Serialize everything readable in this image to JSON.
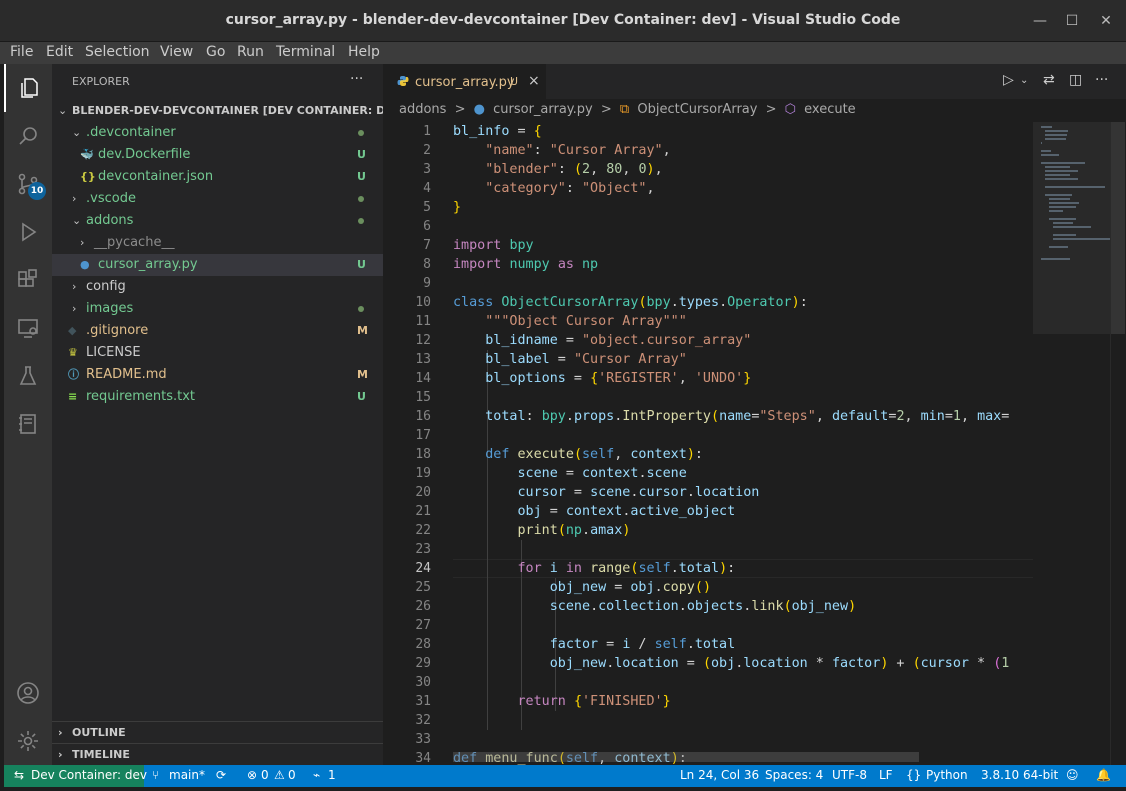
{
  "window": {
    "title": "cursor_array.py - blender-dev-devcontainer [Dev Container: dev] - Visual Studio Code"
  },
  "menu": [
    "File",
    "Edit",
    "Selection",
    "View",
    "Go",
    "Run",
    "Terminal",
    "Help"
  ],
  "activity": {
    "scm_badge": "10"
  },
  "explorer": {
    "header": "EXPLORER",
    "more": "···",
    "root": "BLENDER-DEV-DEVCONTAINER [DEV CONTAINER: DEV]",
    "items": [
      {
        "label": ".devcontainer",
        "kind": "folder-open",
        "status": "dot",
        "color": "#73c991"
      },
      {
        "label": "dev.Dockerfile",
        "kind": "docker",
        "status": "U",
        "color": "#73c991"
      },
      {
        "label": "devcontainer.json",
        "kind": "json",
        "status": "U",
        "color": "#73c991"
      },
      {
        "label": ".vscode",
        "kind": "folder",
        "status": "dot",
        "color": "#73c991"
      },
      {
        "label": "addons",
        "kind": "folder-open",
        "status": "dot",
        "color": "#73c991"
      },
      {
        "label": "__pycache__",
        "kind": "folder",
        "status": "",
        "color": "#8c8c8c"
      },
      {
        "label": "cursor_array.py",
        "kind": "python",
        "status": "U",
        "color": "#73c991"
      },
      {
        "label": "config",
        "kind": "folder",
        "status": "",
        "color": "#cccccc"
      },
      {
        "label": "images",
        "kind": "folder",
        "status": "dot",
        "color": "#73c991"
      },
      {
        "label": ".gitignore",
        "kind": "gitignore",
        "status": "M",
        "color": "#e2c08d"
      },
      {
        "label": "LICENSE",
        "kind": "license",
        "status": "",
        "color": "#cccccc"
      },
      {
        "label": "README.md",
        "kind": "info",
        "status": "M",
        "color": "#e2c08d"
      },
      {
        "label": "requirements.txt",
        "kind": "text",
        "status": "U",
        "color": "#73c991"
      }
    ],
    "outline": "OUTLINE",
    "timeline": "TIMELINE"
  },
  "editor": {
    "tab": {
      "name": "cursor_array.py",
      "status": "U",
      "close": "×"
    },
    "breadcrumb": [
      "addons",
      ">",
      "cursor_array.py",
      ">",
      "ObjectCursorArray",
      ">",
      "execute"
    ],
    "current_line": 24,
    "line_numbers": [
      "1",
      "2",
      "3",
      "4",
      "5",
      "6",
      "7",
      "8",
      "9",
      "10",
      "11",
      "12",
      "13",
      "14",
      "15",
      "16",
      "17",
      "18",
      "19",
      "20",
      "21",
      "22",
      "23",
      "24",
      "25",
      "26",
      "27",
      "28",
      "29",
      "30",
      "31",
      "32",
      "33",
      "34"
    ],
    "code": [
      "bl_info = {",
      "    \"name\": \"Cursor Array\",",
      "    \"blender\": (2, 80, 0),",
      "    \"category\": \"Object\",",
      "}",
      "",
      "import bpy",
      "import numpy as np",
      "",
      "class ObjectCursorArray(bpy.types.Operator):",
      "    \"\"\"Object Cursor Array\"\"\"",
      "    bl_idname = \"object.cursor_array\"",
      "    bl_label = \"Cursor Array\"",
      "    bl_options = {'REGISTER', 'UNDO'}",
      "",
      "    total: bpy.props.IntProperty(name=\"Steps\", default=2, min=1, max=",
      "",
      "    def execute(self, context):",
      "        scene = context.scene",
      "        cursor = scene.cursor.location",
      "        obj = context.active_object",
      "        print(np.amax)",
      "",
      "        for i in range(self.total):",
      "            obj_new = obj.copy()",
      "            scene.collection.objects.link(obj_new)",
      "",
      "            factor = i / self.total",
      "            obj_new.location = (obj.location * factor) + (cursor * (1",
      "",
      "        return {'FINISHED'}",
      "",
      "",
      "def menu_func(self, context):"
    ]
  },
  "statusbar": {
    "remote": "Dev Container: dev",
    "branch": "main*",
    "errors": "0",
    "warnings": "0",
    "ports": "1",
    "position": "Ln 24, Col 36",
    "spaces": "Spaces: 4",
    "encoding": "UTF-8",
    "eol": "LF",
    "language": "Python",
    "interpreter": "3.8.10 64-bit"
  }
}
